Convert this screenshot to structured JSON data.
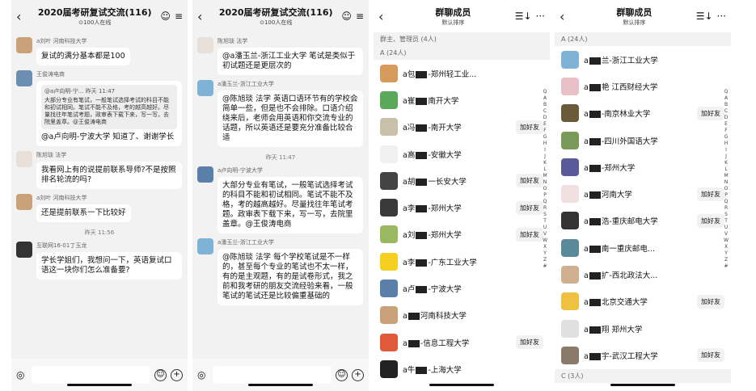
{
  "chat": {
    "title": "2020届考研复试交流(116)",
    "subtitle": "⊙100人在线",
    "back": "‹",
    "right_icons": [
      "☺",
      "≡"
    ],
    "screen1": [
      {
        "type": "msg",
        "sender": "a刘叶 河南科技大学",
        "text": "复试的满分基本都是100",
        "avatar_color": "#c9a27a"
      },
      {
        "type": "msg",
        "sender": "王俊涛电商",
        "quote_head": "@a卢向明-宁... 昨天 11:47",
        "quote": "大部分专业有笔试，一般笔试选择考试的科目不能和初试相同。笔试不能不及格，考的越高越好。尽量找往年笔试考题，政审表下载下来，写一写，去院里盖章。@王俊涛电商",
        "text": "@a卢向明-宁波大学 知道了、谢谢学长",
        "avatar_color": "#6b8fb3"
      },
      {
        "type": "msg",
        "sender": "陈旭琰 法学",
        "text": "我看网上有的说提前联系导师?不是按照排名轮流的吗?",
        "avatar_color": "#e8e0d8"
      },
      {
        "type": "msg",
        "sender": "a刘叶 河南科技大学",
        "text": "还是提前联系一下比较好",
        "avatar_color": "#c9a27a"
      },
      {
        "type": "time",
        "text": "昨天 11:56"
      },
      {
        "type": "msg",
        "sender": "互联网16-01丁玉龙",
        "text": "学长学姐们，我想问一下，英语复试口语这一块你们怎么准备要?",
        "avatar_color": "#333333"
      }
    ],
    "screen2": [
      {
        "type": "msg",
        "sender": "陈旭琰 法学",
        "text": "@a潘玉兰-浙江工业大学 笔试是类似于初试题还是更层次的",
        "avatar_color": "#e8e0d8"
      },
      {
        "type": "msg",
        "sender": "a潘玉兰-浙江工业大学",
        "text": "@陈旭琰 法学 英语口语环节有的学校会简单一些，但是也不会排除。口语介绍绕来后，老师会用英语和你交流专业的话题，所以英语还是要充分准备比较合适",
        "avatar_color": "#7fb3d5"
      },
      {
        "type": "time",
        "text": "昨天 11:47"
      },
      {
        "type": "msg",
        "sender": "a卢向明-宁波大学",
        "text": "大部分专业有笔试，一般笔试选择考试的科目不能和初试相同。笔试不能不及格，考的越高越好。尽量找往年笔试考题。政审表下载下来，写一写，去院里盖章。@王俊涛电商",
        "avatar_color": "#5a7fa8"
      },
      {
        "type": "msg",
        "sender": "a潘玉兰-浙江工业大学",
        "text": "@陈旭琰 法学 每个学校笔试是不一样的，甚至每个专业的笔试也不太一样，有的是主观题，有的是试卷形式，我之前和我考研的朋友交流经验来看，一般笔试的笔试还是比较偏重基础的",
        "avatar_color": "#7fb3d5"
      }
    ],
    "input_icons": {
      "mic": "◎",
      "emoji": "☺",
      "plus": "+"
    }
  },
  "members": {
    "title": "群聊成员",
    "subtitle": "默认排序",
    "back": "‹",
    "sort_icon": "☰↓",
    "more_icon": "···",
    "owner_section": "群主、管理员 (4人)",
    "section_a": "A (24人)",
    "section_c": "C (3人)",
    "add_label": "加好友",
    "alphabet": [
      "Q",
      "A",
      "B",
      "C",
      "D",
      "E",
      "F",
      "G",
      "H",
      "I",
      "J",
      "K",
      "L",
      "M",
      "N",
      "O",
      "P",
      "Q",
      "R",
      "S",
      "T",
      "U",
      "V",
      "W",
      "X",
      "Y",
      "Z",
      "#"
    ],
    "list1": [
      {
        "pre": "a包",
        "post": "-郑州轻工业...",
        "add": false,
        "color": "#d69a5a"
      },
      {
        "pre": "a崔",
        "post": "南开大学",
        "add": false,
        "color": "#5aa85a"
      },
      {
        "pre": "a冯",
        "post": "-南开大学",
        "add": true,
        "color": "#c8c0a8"
      },
      {
        "pre": "a高",
        "post": "-安徽大学",
        "add": false,
        "color": "#f0f0f0"
      },
      {
        "pre": "a胡",
        "post": "一长安大学",
        "add": true,
        "color": "#444444"
      },
      {
        "pre": "a李",
        "post": "-郑州大学",
        "add": true,
        "color": "#3a3a3a"
      },
      {
        "pre": "a刘",
        "post": "-郑州大学",
        "add": true,
        "color": "#9ab860"
      },
      {
        "pre": "a李",
        "post": "-广东工业大学",
        "add": false,
        "color": "#f5d020"
      },
      {
        "pre": "a卢",
        "post": "-宁波大学",
        "add": false,
        "color": "#5a7fa8"
      },
      {
        "pre": "a",
        "post": "河南科技大学",
        "add": false,
        "color": "#c9a27a"
      },
      {
        "pre": "a",
        "post": "-信息工程大学",
        "add": true,
        "color": "#e05a3a"
      },
      {
        "pre": "a牛",
        "post": "-上海大学",
        "add": false,
        "color": "#222222"
      }
    ],
    "list2": [
      {
        "pre": "a",
        "post": "兰-浙江工业大学",
        "add": false,
        "color": "#7fb3d5"
      },
      {
        "pre": "a",
        "post": "艳 江西财经大学",
        "add": false,
        "color": "#e8c0c8"
      },
      {
        "pre": "a",
        "post": "-南京林业大学",
        "add": true,
        "color": "#6b5a3a"
      },
      {
        "pre": "a",
        "post": "-四川外国语大学",
        "add": false,
        "color": "#7a9a5a"
      },
      {
        "pre": "a",
        "post": "-郑州大学",
        "add": false,
        "color": "#5a5a9a"
      },
      {
        "pre": "a",
        "post": "河南大学",
        "add": true,
        "color": "#f0e0e0"
      },
      {
        "pre": "a",
        "post": "浩-重庆邮电大学",
        "add": true,
        "color": "#333333"
      },
      {
        "pre": "a",
        "post": "南一重庆邮电...",
        "add": false,
        "color": "#5a8a9a"
      },
      {
        "pre": "a",
        "post": "扩-西北政法大...",
        "add": false,
        "color": "#d0b090"
      },
      {
        "pre": "a",
        "post": "北京交通大学",
        "add": true,
        "color": "#f0c040"
      },
      {
        "pre": "a",
        "post": "翔 郑州大学",
        "add": false,
        "color": "#e0e0e0"
      },
      {
        "pre": "a",
        "post": "宇-武汉工程大学",
        "add": true,
        "color": "#8a7a6a"
      }
    ]
  }
}
